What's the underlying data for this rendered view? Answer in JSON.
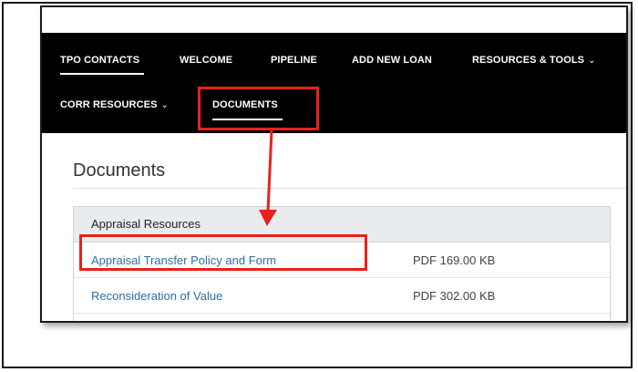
{
  "nav": {
    "row1": [
      {
        "label": "TPO CONTACTS"
      },
      {
        "label": "WELCOME"
      },
      {
        "label": "PIPELINE"
      },
      {
        "label": "ADD NEW LOAN"
      },
      {
        "label": "RESOURCES & TOOLS",
        "dropdown_glyph": "⌄"
      }
    ],
    "row2": [
      {
        "label": "CORR RESOURCES",
        "dropdown_glyph": "⌄"
      },
      {
        "label": "DOCUMENTS"
      }
    ],
    "active_item": "DOCUMENTS"
  },
  "page": {
    "title": "Documents"
  },
  "documents_panel": {
    "header": "Appraisal Resources",
    "rows": [
      {
        "name": "Appraisal Transfer Policy and Form",
        "meta": "PDF 169.00 KB"
      },
      {
        "name": "Reconsideration of Value",
        "meta": "PDF 302.00 KB"
      }
    ]
  },
  "annotation": {
    "highlight_color": "#e8211c",
    "arrow_icon": "arrow-down-icon"
  }
}
